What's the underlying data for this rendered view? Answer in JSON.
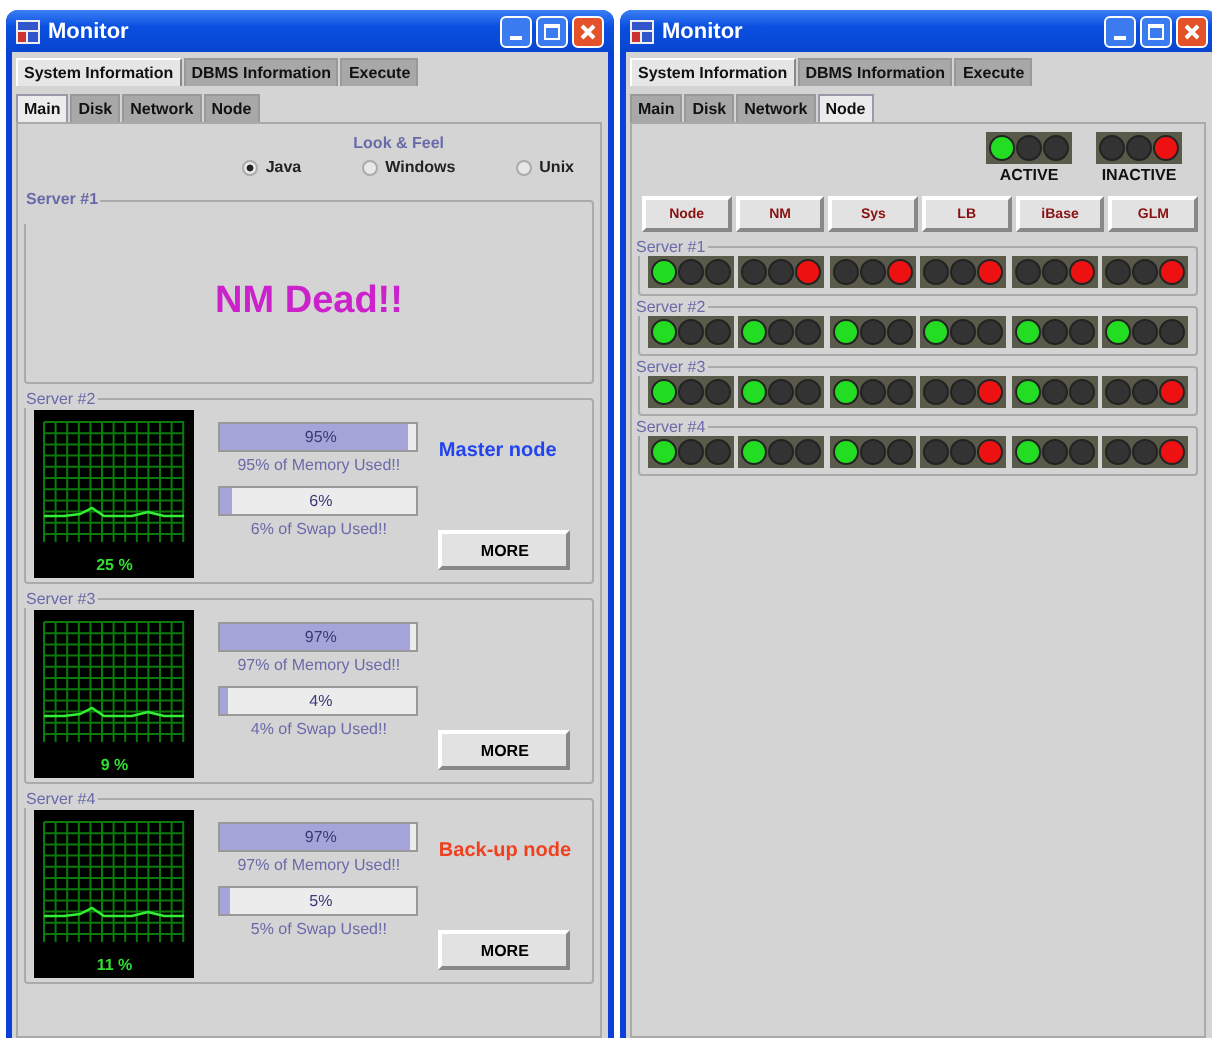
{
  "windows": [
    {
      "title": "Monitor",
      "kind": "main",
      "tabs": [
        {
          "label": "System Information",
          "selected": true
        },
        {
          "label": "DBMS Information",
          "selected": false
        },
        {
          "label": "Execute",
          "selected": false
        }
      ],
      "subtabs": [
        {
          "label": "Main",
          "selected": true
        },
        {
          "label": "Disk",
          "selected": false
        },
        {
          "label": "Network",
          "selected": false
        },
        {
          "label": "Node",
          "selected": false
        }
      ],
      "look_feel": {
        "title": "Look & Feel",
        "options": [
          {
            "label": "Java",
            "selected": true
          },
          {
            "label": "Windows",
            "selected": false
          },
          {
            "label": "Unix",
            "selected": false
          }
        ]
      },
      "servers": [
        {
          "title": "Server #1",
          "kind": "dead",
          "message": "NM Dead!!"
        },
        {
          "title": "Server #2",
          "kind": "stats",
          "cpu_reading": "25 %",
          "memory": {
            "level": 0.95,
            "text": "95%",
            "caption": "95% of Memory Used!!"
          },
          "swap": {
            "level": 0.06,
            "text": "6%",
            "caption": "6% of Swap Used!!"
          },
          "role": {
            "kind": "master",
            "text": "Master node"
          },
          "button": "MORE"
        },
        {
          "title": "Server #3",
          "kind": "stats",
          "cpu_reading": "9 %",
          "memory": {
            "level": 0.97,
            "text": "97%",
            "caption": "97% of Memory Used!!"
          },
          "swap": {
            "level": 0.04,
            "text": "4%",
            "caption": "4% of Swap Used!!"
          },
          "button": "MORE"
        },
        {
          "title": "Server #4",
          "kind": "stats",
          "cpu_reading": "11 %",
          "memory": {
            "level": 0.97,
            "text": "97%",
            "caption": "97% of Memory Used!!"
          },
          "swap": {
            "level": 0.05,
            "text": "5%",
            "caption": "5% of Swap Used!!"
          },
          "role": {
            "kind": "backup",
            "text": "Back-up node"
          },
          "button": "MORE"
        }
      ]
    },
    {
      "title": "Monitor",
      "kind": "node",
      "tabs": [
        {
          "label": "System Information",
          "selected": true
        },
        {
          "label": "DBMS Information",
          "selected": false
        },
        {
          "label": "Execute",
          "selected": false
        }
      ],
      "subtabs": [
        {
          "label": "Main",
          "selected": false
        },
        {
          "label": "Disk",
          "selected": false
        },
        {
          "label": "Network",
          "selected": false
        },
        {
          "label": "Node",
          "selected": true
        }
      ],
      "legend": [
        {
          "label": "ACTIVE",
          "active": true
        },
        {
          "label": "INACTIVE",
          "active": false
        }
      ],
      "columns": [
        "Node",
        "NM",
        "Sys",
        "LB",
        "iBase",
        "GLM"
      ],
      "servers": [
        {
          "title": "Server #1",
          "lights": [
            {
              "active": true
            },
            {
              "active": false
            },
            {
              "active": false
            },
            {
              "active": false
            },
            {
              "active": false
            },
            {
              "active": false
            }
          ]
        },
        {
          "title": "Server #2",
          "lights": [
            {
              "active": true
            },
            {
              "active": true
            },
            {
              "active": true
            },
            {
              "active": true
            },
            {
              "active": true
            },
            {
              "active": true
            }
          ]
        },
        {
          "title": "Server #3",
          "lights": [
            {
              "active": true
            },
            {
              "active": true
            },
            {
              "active": true
            },
            {
              "active": false
            },
            {
              "active": true
            },
            {
              "active": false
            }
          ]
        },
        {
          "title": "Server #4",
          "lights": [
            {
              "active": true
            },
            {
              "active": true
            },
            {
              "active": true
            },
            {
              "active": false
            },
            {
              "active": true
            },
            {
              "active": false
            }
          ]
        }
      ]
    }
  ]
}
